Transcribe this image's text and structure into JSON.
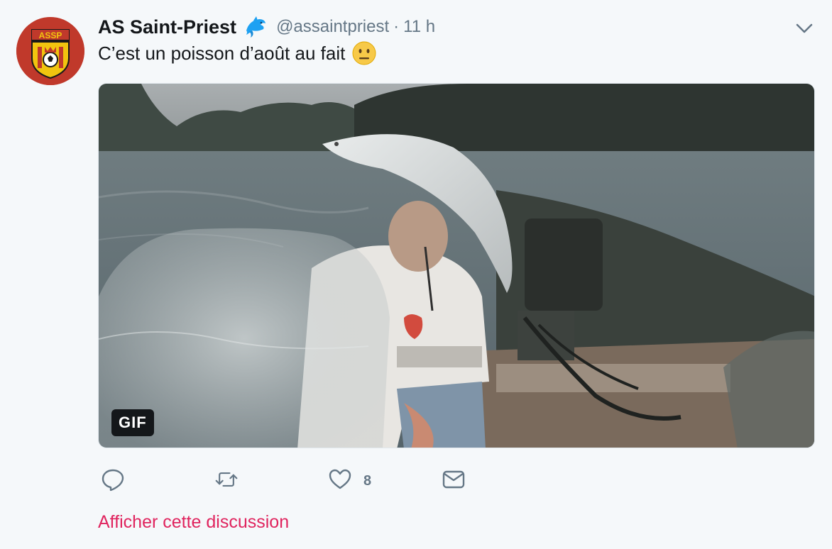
{
  "tweet": {
    "author_name": "AS Saint-Priest",
    "badge_icon": "dolphin-icon",
    "handle": "@assaintpriest",
    "separator": "·",
    "time": "11 h",
    "text": "C’est un poisson d’août au fait",
    "emoji_icon": "neutral-face-emoji",
    "avatar_text": "ASSP",
    "media": {
      "badge": "GIF"
    },
    "actions": {
      "reply_icon": "reply-icon",
      "retweet_icon": "retweet-icon",
      "like_icon": "heart-icon",
      "like_count": "8",
      "message_icon": "mail-icon"
    },
    "discussion_link": "Afficher cette discussion"
  },
  "colors": {
    "background": "#f5f8fa",
    "link": "#e0245e",
    "secondary_text": "#657786",
    "badge_blue": "#1da1f2"
  }
}
